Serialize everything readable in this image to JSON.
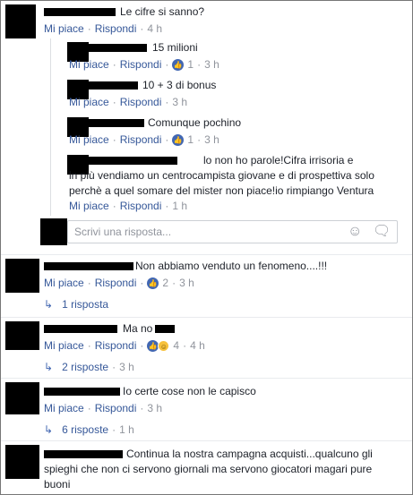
{
  "labels": {
    "like": "Mi piace",
    "reply": "Rispondi",
    "sep": "·",
    "write_reply_placeholder": "Scrivi una risposta..."
  },
  "comments": [
    {
      "text": "Le cifre si sanno?",
      "time": "4 h"
    },
    {
      "text": "15 milioni",
      "reactions": "1",
      "time": "3 h"
    },
    {
      "text": "10 + 3 di bonus",
      "time": "3 h"
    },
    {
      "text": "Comunque pochino",
      "reactions": "1",
      "time": "3 h"
    },
    {
      "text_lines": [
        "lo non ho parole!Cifra irrisoria e",
        "in più vendiamo un centrocampista giovane e di prospettiva solo",
        "perchè a quel somare del mister non piace!io rimpiango Ventura"
      ],
      "time": "1 h"
    },
    {
      "text": "Non abbiamo venduto un fenomeno....!!!",
      "reactions": "2",
      "time": "3 h",
      "replies": "1 risposta"
    },
    {
      "text": "Ma no ca",
      "reactions": "4",
      "time": "4 h",
      "replies": "2 risposte",
      "replies_time": "3 h"
    },
    {
      "text": "Io certe cose non le capisco",
      "time": "3 h",
      "replies": "6 risposte",
      "replies_time": "1 h"
    },
    {
      "text_lines": [
        "Continua la nostra campagna acquisti...qualcuno gli",
        "spieghi che non ci servono giornali ma servono giocatori magari pure",
        "buoni"
      ]
    }
  ],
  "icons": {
    "like": "like-icon",
    "haha": "haha-icon",
    "emoji": "emoji-icon",
    "sticker": "sticker-icon",
    "reply_arrow": "reply-arrow-icon"
  },
  "colors": {
    "link": "#365899",
    "meta": "#90949c",
    "like_blue": "#4267b2"
  }
}
